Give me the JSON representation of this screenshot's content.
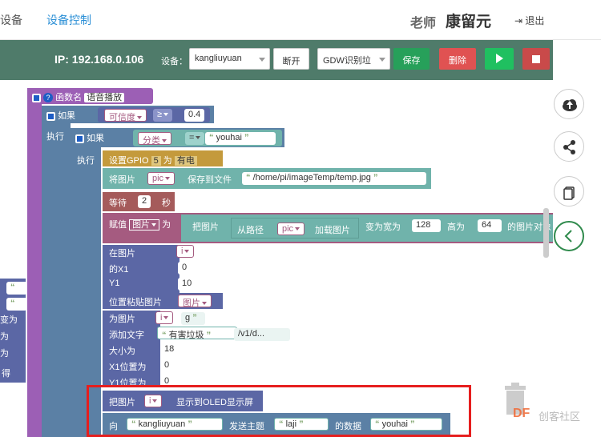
{
  "topnav": {
    "nav_device": "设备",
    "nav_device_control": "设备控制",
    "teacher_label": "老师",
    "user_name": "康留元",
    "logout": "退出"
  },
  "toolbar": {
    "ip": "IP: 192.168.0.106",
    "device_label": "设备：",
    "device_value": "kangliuyuan",
    "disconnect": "断开",
    "model_value": "GDW识别垃",
    "save": "保存",
    "delete": "删除"
  },
  "blocks": {
    "func_label": "函数名",
    "func_name": "语音播放",
    "if1": "如果",
    "confidence": "可信度",
    "gte": "≥",
    "threshold": "0.4",
    "exec1": "执行",
    "if2": "如果",
    "category": "分类",
    "eq": "=",
    "harmful": "youhai",
    "exec2": "执行",
    "set_gpio": "设置GPIO",
    "gpio_num": "5",
    "as": "为",
    "power": "有电",
    "save_img": "将图片",
    "pic": "pic",
    "save_to_file": "保存到文件",
    "file_path": "/home/pi/imageTemp/temp.jpg",
    "wait": "等待",
    "wait_val": "2",
    "sec": "秒",
    "assign": "赋值",
    "img_var": "图片",
    "as2": "为",
    "take_img": "把图片",
    "from_path": "从路径",
    "load_img": "加载图片",
    "resize_w": "变为宽为",
    "w_val": "128",
    "h_label": "高为",
    "h_val": "64",
    "img_obj": "的图片对象",
    "in_img": "在图片",
    "i_var": "i",
    "x1": "的X1",
    "x1_val": "0",
    "y1": "Y1",
    "y1_val": "10",
    "paste_pos": "位置粘贴图片",
    "img2": "图片",
    "for_img": "为图片",
    "i2": "i",
    "add_text": "添加文字",
    "text_val": "有害垃圾",
    "frag_g": "g",
    "frag_url": "/v1/d...",
    "size": "大小为",
    "size_val": "18",
    "x1_pos": "X1位置为",
    "x1_pos_val": "0",
    "y1_pos": "Y1位置为",
    "y1_pos_val": "0",
    "show_img": "把图片",
    "i3": "i",
    "show_oled": "显示到OLED显示屏",
    "to": "向",
    "client": "kangliuyuan",
    "send_topic": "发送主题",
    "topic": "laji",
    "data_of": "的数据",
    "payload": "youhai",
    "left_frag1": "变为",
    "left_frag2": "为",
    "left_frag3": "为",
    "left_frag4": "得"
  },
  "watermark": {
    "brand": "DF",
    "suffix": "创客社区"
  },
  "colors": {
    "toolbar": "#4f7b6a",
    "proc": "#9c5fb5",
    "logic": "#5b80a5",
    "io": "#c49a3c",
    "text": "#70b3ab",
    "math": "#5b67a5",
    "var": "#a55b80",
    "wait": "#a55b5b",
    "green_save": "#27a05a",
    "red_delete": "#e05252",
    "run": "#20c060",
    "stop": "#c94a4a"
  }
}
